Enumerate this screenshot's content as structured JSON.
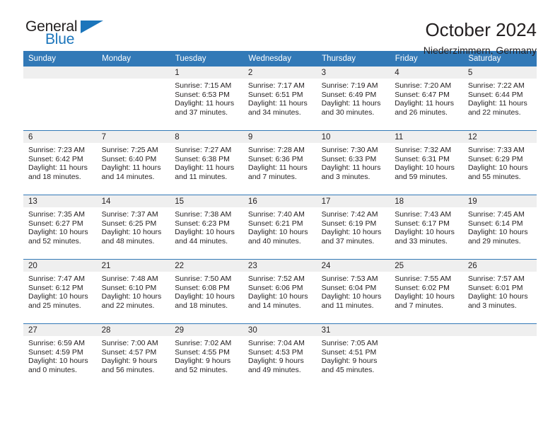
{
  "brand": {
    "name_top": "General",
    "name_bottom": "Blue",
    "color_dark": "#221f1f",
    "color_blue": "#1b75bb"
  },
  "header": {
    "title": "October 2024",
    "subtitle": "Niederzimmern, Germany"
  },
  "theme": {
    "header_blue": "#3279b7",
    "daynum_gray": "#efefef",
    "text": "#231f20"
  },
  "weekdays": [
    "Sunday",
    "Monday",
    "Tuesday",
    "Wednesday",
    "Thursday",
    "Friday",
    "Saturday"
  ],
  "labels": {
    "sunrise": "Sunrise:",
    "sunset": "Sunset:",
    "daylight": "Daylight:"
  },
  "weeks": [
    [
      {
        "day": "",
        "blank": true
      },
      {
        "day": "",
        "blank": true
      },
      {
        "day": "1",
        "sunrise": "Sunrise: 7:15 AM",
        "sunset": "Sunset: 6:53 PM",
        "daylight": "Daylight: 11 hours and 37 minutes."
      },
      {
        "day": "2",
        "sunrise": "Sunrise: 7:17 AM",
        "sunset": "Sunset: 6:51 PM",
        "daylight": "Daylight: 11 hours and 34 minutes."
      },
      {
        "day": "3",
        "sunrise": "Sunrise: 7:19 AM",
        "sunset": "Sunset: 6:49 PM",
        "daylight": "Daylight: 11 hours and 30 minutes."
      },
      {
        "day": "4",
        "sunrise": "Sunrise: 7:20 AM",
        "sunset": "Sunset: 6:47 PM",
        "daylight": "Daylight: 11 hours and 26 minutes."
      },
      {
        "day": "5",
        "sunrise": "Sunrise: 7:22 AM",
        "sunset": "Sunset: 6:44 PM",
        "daylight": "Daylight: 11 hours and 22 minutes."
      }
    ],
    [
      {
        "day": "6",
        "sunrise": "Sunrise: 7:23 AM",
        "sunset": "Sunset: 6:42 PM",
        "daylight": "Daylight: 11 hours and 18 minutes."
      },
      {
        "day": "7",
        "sunrise": "Sunrise: 7:25 AM",
        "sunset": "Sunset: 6:40 PM",
        "daylight": "Daylight: 11 hours and 14 minutes."
      },
      {
        "day": "8",
        "sunrise": "Sunrise: 7:27 AM",
        "sunset": "Sunset: 6:38 PM",
        "daylight": "Daylight: 11 hours and 11 minutes."
      },
      {
        "day": "9",
        "sunrise": "Sunrise: 7:28 AM",
        "sunset": "Sunset: 6:36 PM",
        "daylight": "Daylight: 11 hours and 7 minutes."
      },
      {
        "day": "10",
        "sunrise": "Sunrise: 7:30 AM",
        "sunset": "Sunset: 6:33 PM",
        "daylight": "Daylight: 11 hours and 3 minutes."
      },
      {
        "day": "11",
        "sunrise": "Sunrise: 7:32 AM",
        "sunset": "Sunset: 6:31 PM",
        "daylight": "Daylight: 10 hours and 59 minutes."
      },
      {
        "day": "12",
        "sunrise": "Sunrise: 7:33 AM",
        "sunset": "Sunset: 6:29 PM",
        "daylight": "Daylight: 10 hours and 55 minutes."
      }
    ],
    [
      {
        "day": "13",
        "sunrise": "Sunrise: 7:35 AM",
        "sunset": "Sunset: 6:27 PM",
        "daylight": "Daylight: 10 hours and 52 minutes."
      },
      {
        "day": "14",
        "sunrise": "Sunrise: 7:37 AM",
        "sunset": "Sunset: 6:25 PM",
        "daylight": "Daylight: 10 hours and 48 minutes."
      },
      {
        "day": "15",
        "sunrise": "Sunrise: 7:38 AM",
        "sunset": "Sunset: 6:23 PM",
        "daylight": "Daylight: 10 hours and 44 minutes."
      },
      {
        "day": "16",
        "sunrise": "Sunrise: 7:40 AM",
        "sunset": "Sunset: 6:21 PM",
        "daylight": "Daylight: 10 hours and 40 minutes."
      },
      {
        "day": "17",
        "sunrise": "Sunrise: 7:42 AM",
        "sunset": "Sunset: 6:19 PM",
        "daylight": "Daylight: 10 hours and 37 minutes."
      },
      {
        "day": "18",
        "sunrise": "Sunrise: 7:43 AM",
        "sunset": "Sunset: 6:17 PM",
        "daylight": "Daylight: 10 hours and 33 minutes."
      },
      {
        "day": "19",
        "sunrise": "Sunrise: 7:45 AM",
        "sunset": "Sunset: 6:14 PM",
        "daylight": "Daylight: 10 hours and 29 minutes."
      }
    ],
    [
      {
        "day": "20",
        "sunrise": "Sunrise: 7:47 AM",
        "sunset": "Sunset: 6:12 PM",
        "daylight": "Daylight: 10 hours and 25 minutes."
      },
      {
        "day": "21",
        "sunrise": "Sunrise: 7:48 AM",
        "sunset": "Sunset: 6:10 PM",
        "daylight": "Daylight: 10 hours and 22 minutes."
      },
      {
        "day": "22",
        "sunrise": "Sunrise: 7:50 AM",
        "sunset": "Sunset: 6:08 PM",
        "daylight": "Daylight: 10 hours and 18 minutes."
      },
      {
        "day": "23",
        "sunrise": "Sunrise: 7:52 AM",
        "sunset": "Sunset: 6:06 PM",
        "daylight": "Daylight: 10 hours and 14 minutes."
      },
      {
        "day": "24",
        "sunrise": "Sunrise: 7:53 AM",
        "sunset": "Sunset: 6:04 PM",
        "daylight": "Daylight: 10 hours and 11 minutes."
      },
      {
        "day": "25",
        "sunrise": "Sunrise: 7:55 AM",
        "sunset": "Sunset: 6:02 PM",
        "daylight": "Daylight: 10 hours and 7 minutes."
      },
      {
        "day": "26",
        "sunrise": "Sunrise: 7:57 AM",
        "sunset": "Sunset: 6:01 PM",
        "daylight": "Daylight: 10 hours and 3 minutes."
      }
    ],
    [
      {
        "day": "27",
        "sunrise": "Sunrise: 6:59 AM",
        "sunset": "Sunset: 4:59 PM",
        "daylight": "Daylight: 10 hours and 0 minutes."
      },
      {
        "day": "28",
        "sunrise": "Sunrise: 7:00 AM",
        "sunset": "Sunset: 4:57 PM",
        "daylight": "Daylight: 9 hours and 56 minutes."
      },
      {
        "day": "29",
        "sunrise": "Sunrise: 7:02 AM",
        "sunset": "Sunset: 4:55 PM",
        "daylight": "Daylight: 9 hours and 52 minutes."
      },
      {
        "day": "30",
        "sunrise": "Sunrise: 7:04 AM",
        "sunset": "Sunset: 4:53 PM",
        "daylight": "Daylight: 9 hours and 49 minutes."
      },
      {
        "day": "31",
        "sunrise": "Sunrise: 7:05 AM",
        "sunset": "Sunset: 4:51 PM",
        "daylight": "Daylight: 9 hours and 45 minutes."
      },
      {
        "day": "",
        "blank": true
      },
      {
        "day": "",
        "blank": true
      }
    ]
  ]
}
